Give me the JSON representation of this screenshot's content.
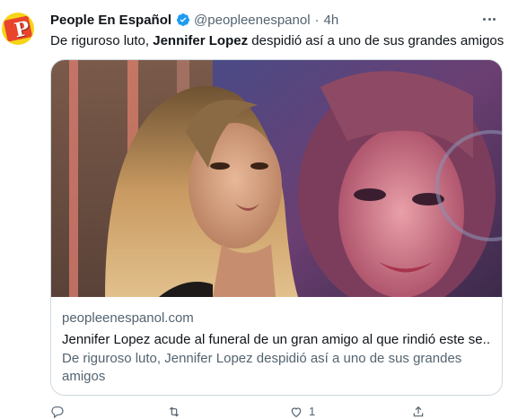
{
  "tweet": {
    "author_name": "People En Español",
    "handle": "@peopleenespanol",
    "separator": "·",
    "time": "4h",
    "text_before": "De riguroso luto, ",
    "text_bold": "Jennifer Lopez",
    "text_after": " despidió así a uno de sus grandes amigos"
  },
  "card": {
    "domain": "peopleenespanol.com",
    "title": "Jennifer Lopez acude al funeral de un gran amigo al que rindió este se...",
    "description": "De riguroso luto, Jennifer Lopez despidió así a uno de sus grandes amigos"
  },
  "actions": {
    "reply_count": "",
    "retweet_count": "",
    "like_count": "1",
    "share_count": ""
  },
  "icons": {
    "avatar_logo": "people-logo-icon",
    "verified": "verified-badge-icon",
    "more": "more-icon",
    "reply": "reply-icon",
    "retweet": "retweet-icon",
    "like": "heart-icon",
    "share": "share-icon"
  },
  "colors": {
    "text": "#0f1419",
    "muted": "#536471",
    "verified": "#1d9bf0",
    "border": "#cfd9de",
    "avatar_bg": "#f7d417"
  }
}
